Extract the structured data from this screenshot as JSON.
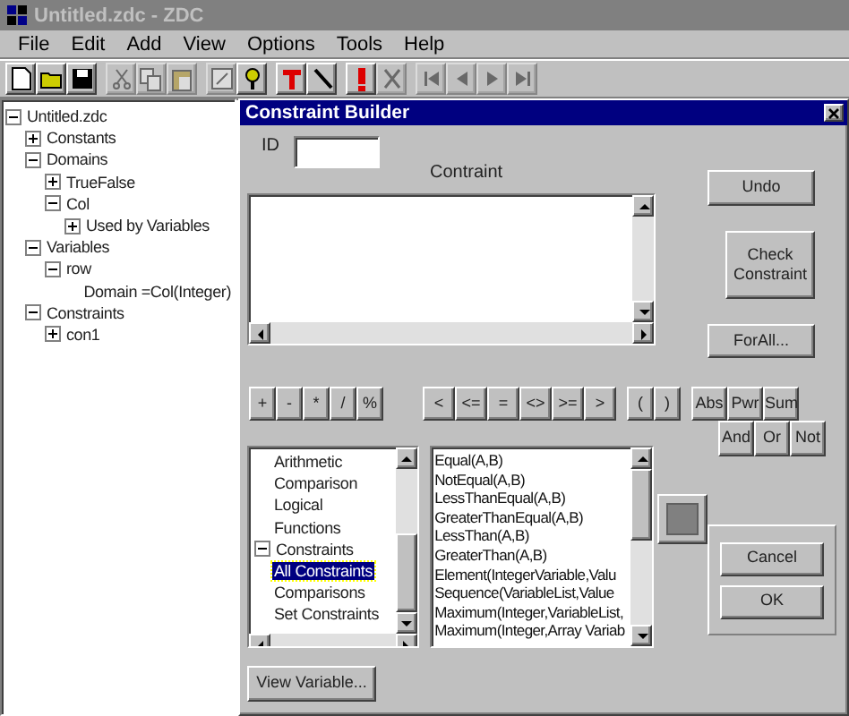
{
  "window": {
    "title": "Untitled.zdc - ZDC",
    "active": false
  },
  "menu": [
    "File",
    "Edit",
    "Add",
    "View",
    "Options",
    "Tools",
    "Help"
  ],
  "toolbar": [
    [
      {
        "kind": "new",
        "disabled": false
      },
      {
        "kind": "open",
        "disabled": false
      },
      {
        "kind": "save",
        "disabled": false
      }
    ],
    [
      {
        "kind": "cut",
        "disabled": true
      },
      {
        "kind": "copy",
        "disabled": true
      },
      {
        "kind": "paste",
        "disabled": true
      }
    ],
    [
      {
        "kind": "edit",
        "disabled": true
      },
      {
        "kind": "hint",
        "disabled": false
      }
    ],
    [
      {
        "kind": "text",
        "disabled": false
      },
      {
        "kind": "line",
        "disabled": false
      }
    ],
    [
      {
        "kind": "alert",
        "disabled": false
      },
      {
        "kind": "delete",
        "disabled": true
      }
    ],
    [
      {
        "kind": "first",
        "disabled": true
      },
      {
        "kind": "prev",
        "disabled": true
      },
      {
        "kind": "next",
        "disabled": true
      },
      {
        "kind": "last",
        "disabled": true
      }
    ]
  ],
  "tree": [
    {
      "label": "Untitled.zdc",
      "expanded": true,
      "children": [
        {
          "label": "Constants",
          "expanded": false
        },
        {
          "label": "Domains",
          "expanded": true,
          "children": [
            {
              "label": "TrueFalse",
              "expanded": false
            },
            {
              "label": "Col",
              "expanded": true,
              "children": [
                {
                  "label": "Used by Variables",
                  "expanded": false
                }
              ]
            }
          ]
        },
        {
          "label": "Variables",
          "expanded": true,
          "children": [
            {
              "label": "row",
              "expanded": true,
              "children": [
                {
                  "label": "Domain =Col(Integer)"
                }
              ]
            }
          ]
        },
        {
          "label": "Constraints",
          "expanded": true,
          "children": [
            {
              "label": "con1",
              "expanded": false
            }
          ]
        }
      ]
    }
  ],
  "dialog": {
    "title": "Constraint Builder",
    "id_label": "ID",
    "constraint_label": "Contraint",
    "side_buttons": [
      "Undo",
      "Check Constraint",
      "ForAll..."
    ],
    "operator_groups": [
      [
        "+",
        "-",
        "*",
        "/",
        "%"
      ],
      [
        "<",
        "<=",
        "=",
        "<>",
        ">=",
        ">"
      ],
      [
        "(",
        ")"
      ],
      [
        "Abs",
        "Pwr",
        "Sum"
      ]
    ],
    "logic_buttons": [
      "And",
      "Or",
      "Not"
    ],
    "categories": [
      {
        "label": "Arithmetic",
        "selected": false
      },
      {
        "label": "Comparison",
        "selected": false
      },
      {
        "label": "Logical",
        "selected": false
      },
      {
        "label": "Functions",
        "selected": false
      },
      {
        "label": "Constraints",
        "expanded": true,
        "selected": false,
        "children": [
          {
            "label": "All Constraints",
            "selected": true
          },
          {
            "label": "Comparisons",
            "selected": false
          },
          {
            "label": "Set Constraints",
            "selected": false
          }
        ]
      }
    ],
    "functions": [
      "Equal(A,B)",
      "NotEqual(A,B)",
      "LessThanEqual(A,B)",
      "GreaterThanEqual(A,B)",
      "LessThan(A,B)",
      "GreaterThan(A,B)",
      "Element(IntegerVariable,Valu",
      "Sequence(VariableList,Value",
      "Maximum(Integer,VariableList,",
      "Maximum(Integer,Array Variab"
    ],
    "dialog_buttons": [
      "Cancel",
      "OK"
    ],
    "view_button": "View Variable..."
  }
}
